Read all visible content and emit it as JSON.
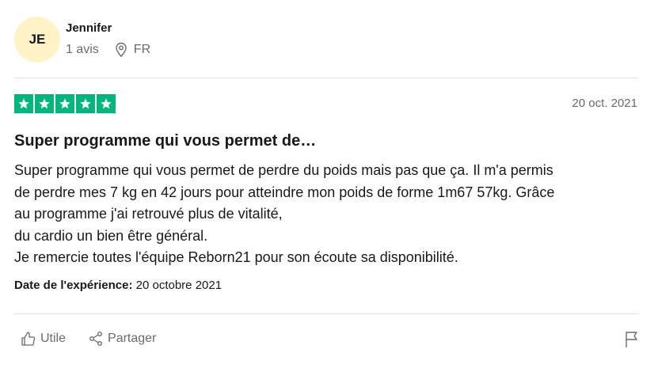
{
  "reviewer": {
    "initials": "JE",
    "name": "Jennifer",
    "review_count": "1 avis",
    "country": "FR",
    "avatar_color": "#fff3c7"
  },
  "review": {
    "rating": 5,
    "max_rating": 5,
    "star_color": "#00b67a",
    "date": "20 oct. 2021",
    "title": "Super programme qui vous permet de…",
    "body_lines": [
      "Super programme qui vous permet de perdre du poids mais pas que ça. Il m'a permis",
      "de perdre mes 7 kg en 42 jours pour atteindre mon poids de forme 1m67 57kg. Grâce",
      "au programme j'ai retrouvé plus de vitalité,",
      "du cardio un bien être général.",
      "Je remercie toutes l'équipe Reborn21 pour son écoute sa disponibilité."
    ],
    "experience_label": "Date de l'expérience:",
    "experience_date": "20 octobre 2021"
  },
  "actions": {
    "useful_label": "Utile",
    "share_label": "Partager",
    "useful_icon": "thumbs-up-icon",
    "share_icon": "share-icon",
    "flag_icon": "flag-icon",
    "location_icon": "location-pin-icon"
  }
}
